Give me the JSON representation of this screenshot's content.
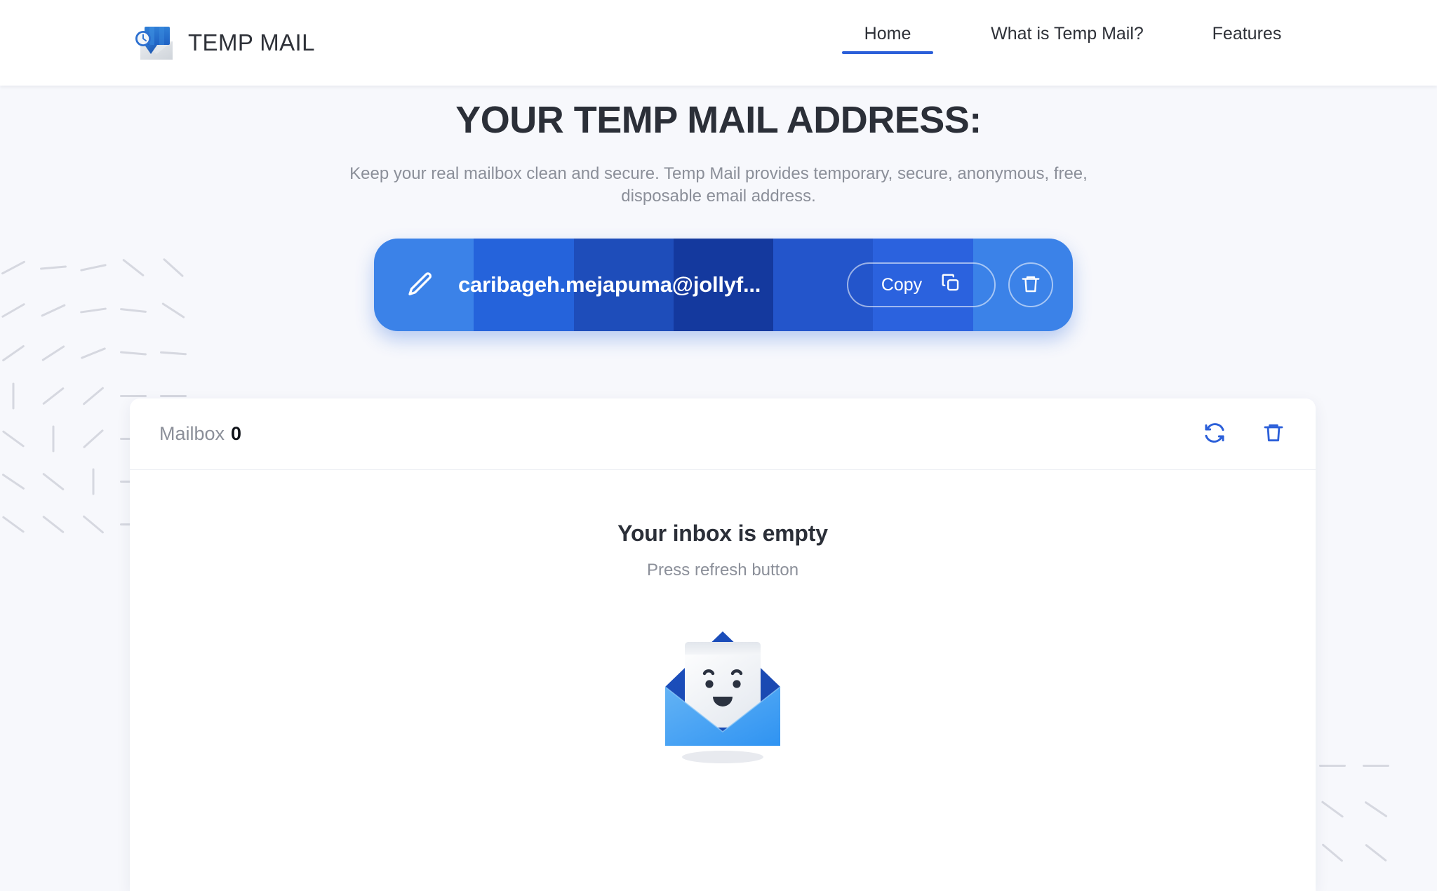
{
  "header": {
    "brand_name": "TEMP MAIL",
    "logo_icon": "envelope-clock-logo",
    "nav": [
      {
        "label": "Home",
        "active": true
      },
      {
        "label": "What is Temp Mail?",
        "active": false
      },
      {
        "label": "Features",
        "active": false
      }
    ]
  },
  "hero": {
    "title": "YOUR TEMP MAIL ADDRESS:",
    "subtitle": "Keep your real mailbox clean and secure. Temp Mail provides temporary, secure, anonymous, free, disposable email address."
  },
  "email_bar": {
    "address": "caribageh.mejapuma@jollyf...",
    "edit_icon": "pencil-icon",
    "copy_label": "Copy",
    "copy_icon": "copy-icon",
    "delete_icon": "trash-icon",
    "band_colors": [
      "#3b82e8",
      "#2563db",
      "#1e4dba",
      "#14399e",
      "#2355cb",
      "#2b62de",
      "#3b82e8"
    ]
  },
  "mailbox": {
    "label": "Mailbox",
    "count": "0",
    "refresh_icon": "refresh-icon",
    "delete_icon": "trash-icon",
    "empty_title": "Your inbox is empty",
    "empty_subtitle": "Press refresh button",
    "empty_illustration": "open-envelope-smiling-letter"
  },
  "colors": {
    "accent": "#2b5fd9",
    "page_bg": "#f7f8fc",
    "header_bg": "#ffffff",
    "muted_text": "#8b8f99",
    "dark_text": "#2b2f38",
    "dash_decor": "#d6d8e0"
  }
}
